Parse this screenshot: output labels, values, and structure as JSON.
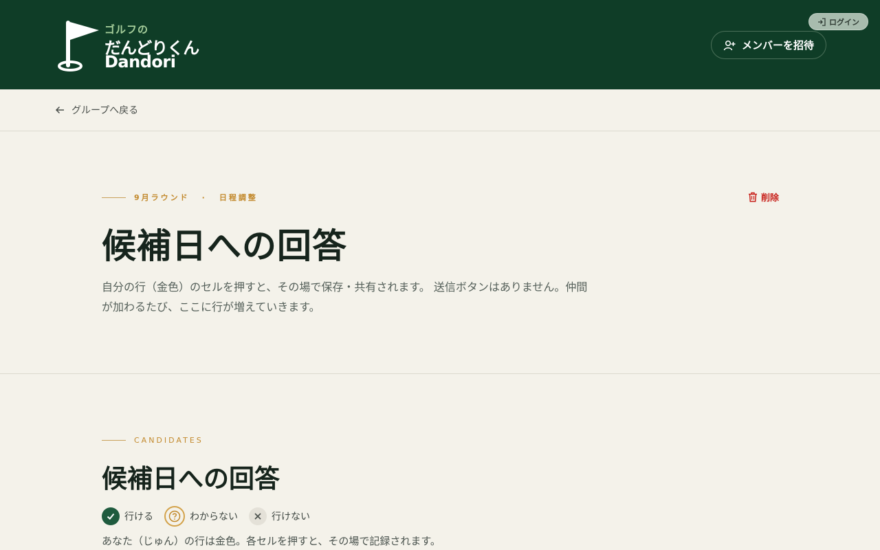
{
  "header": {
    "logo": {
      "sub": "ゴルフの",
      "main": "だんどりくん",
      "en": "Dandori"
    },
    "login_label": "ログイン",
    "invite_label": "メンバーを招待"
  },
  "nav": {
    "back_label": "グループへ戻る"
  },
  "intro": {
    "eyebrow_round": "9月ラウンド",
    "eyebrow_sep": "·",
    "eyebrow_section": "日程調整",
    "delete_label": "削除",
    "title": "候補日への回答",
    "description": "自分の行（金色）のセルを押すと、その場で保存・共有されます。 送信ボタンはありません。仲間が加わるたび、ここに行が増えていきます。"
  },
  "candidates": {
    "eyebrow": "CANDIDATES",
    "title": "候補日への回答",
    "legend": [
      {
        "icon": "check-icon",
        "label": "行ける"
      },
      {
        "icon": "question-icon",
        "label": "わからない"
      },
      {
        "icon": "cross-icon",
        "label": "行けない"
      }
    ],
    "note": "あなた（じゅん）の行は金色。各セルを押すと、その場で記録されます。"
  },
  "colors": {
    "header_bg": "#0f3d27",
    "page_bg": "#f4f2ea",
    "accent_gold": "#c2892c",
    "danger": "#c8231d",
    "yes_green": "#1f5b3e"
  }
}
